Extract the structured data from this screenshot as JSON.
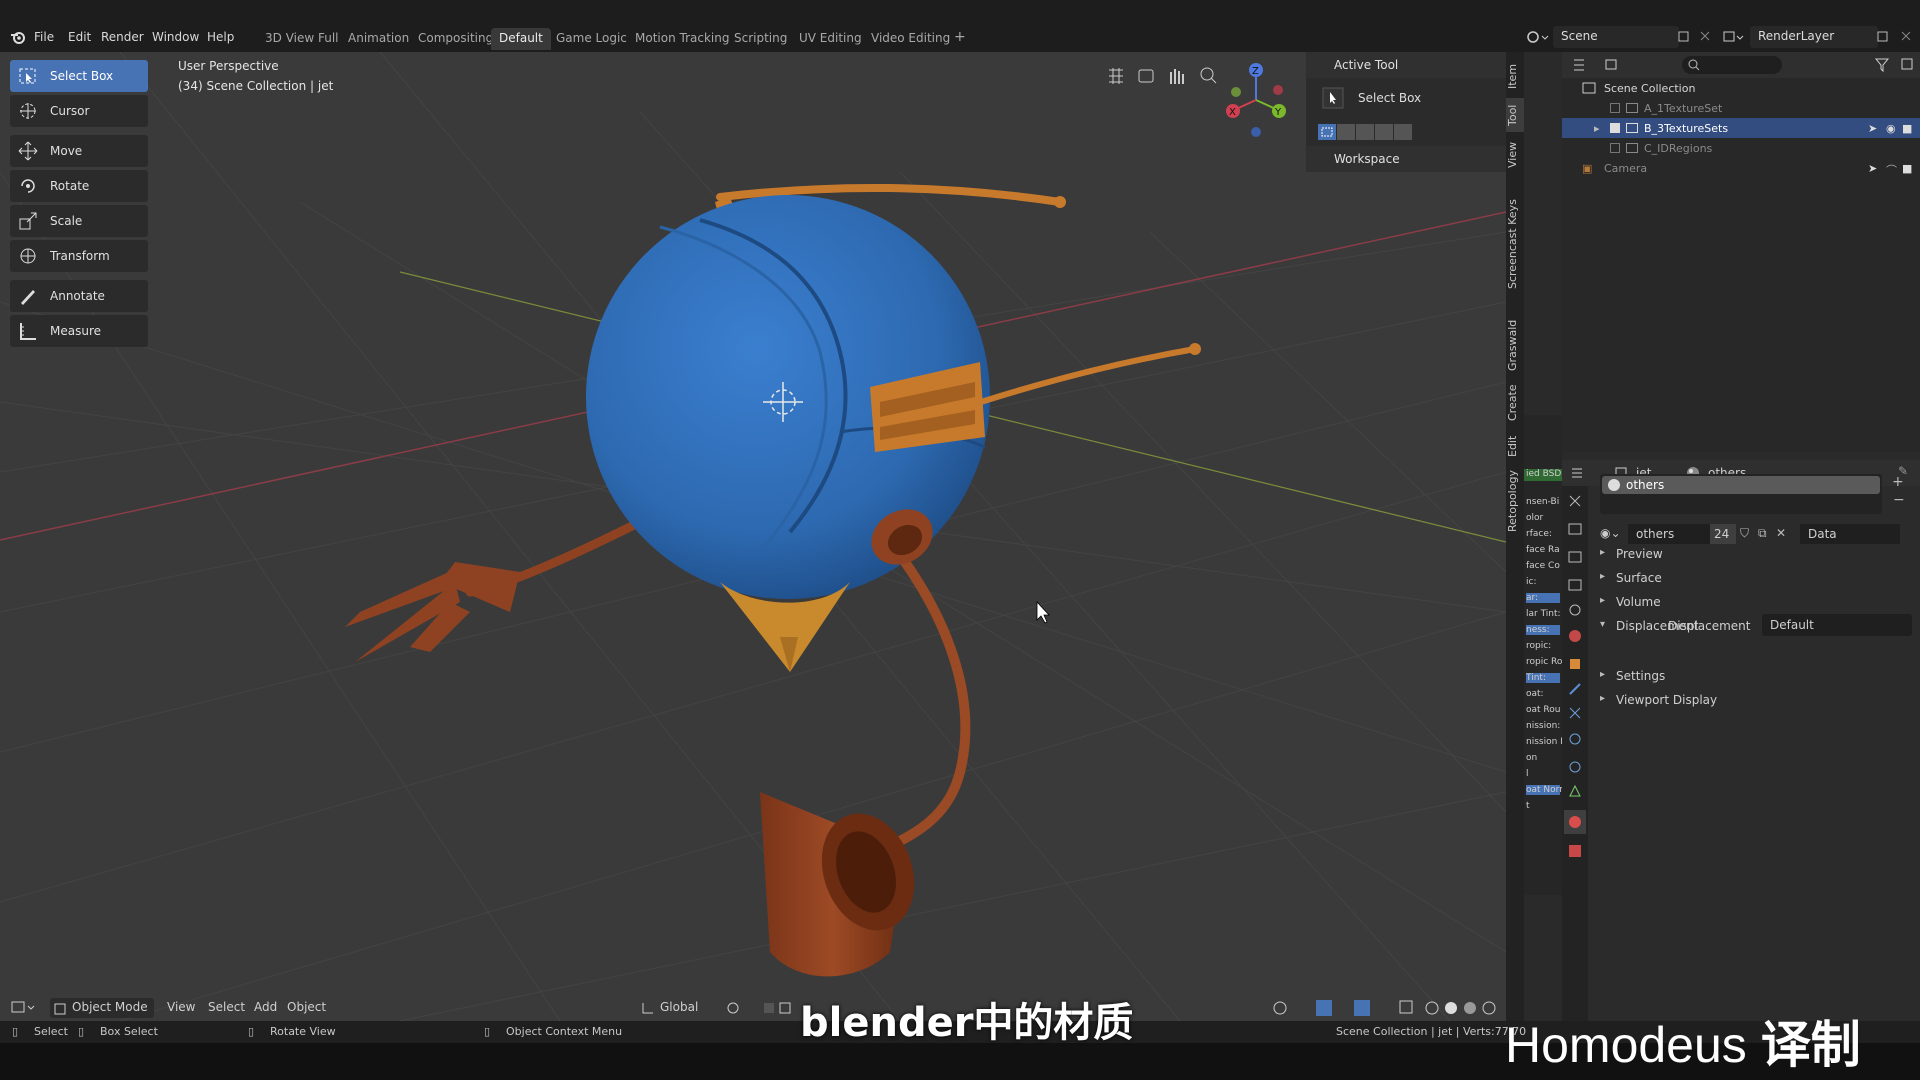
{
  "menu": [
    "File",
    "Edit",
    "Render",
    "Window",
    "Help"
  ],
  "workspace_tabs": [
    {
      "label": "3D View Full",
      "active": false
    },
    {
      "label": "Animation",
      "active": false
    },
    {
      "label": "Compositing",
      "active": false
    },
    {
      "label": "Default",
      "active": true
    },
    {
      "label": "Game Logic",
      "active": false
    },
    {
      "label": "Motion Tracking",
      "active": false
    },
    {
      "label": "Scripting",
      "active": false
    },
    {
      "label": "UV Editing",
      "active": false
    },
    {
      "label": "Video Editing",
      "active": false
    }
  ],
  "add_tab_label": "+",
  "scene_field": "Scene",
  "renderlayer_field": "RenderLayer",
  "viewport": {
    "perspective": "User Perspective",
    "collection_info": "(34) Scene Collection | jet"
  },
  "tools": [
    {
      "label": "Select Box",
      "icon": "select-box-icon",
      "active": true
    },
    {
      "label": "Cursor",
      "icon": "cursor-icon",
      "active": false
    },
    {
      "label": "Move",
      "icon": "move-icon",
      "active": false
    },
    {
      "label": "Rotate",
      "icon": "rotate-icon",
      "active": false
    },
    {
      "label": "Scale",
      "icon": "scale-icon",
      "active": false
    },
    {
      "label": "Transform",
      "icon": "transform-icon",
      "active": false
    },
    {
      "label": "Annotate",
      "icon": "annotate-icon",
      "active": false
    },
    {
      "label": "Measure",
      "icon": "measure-icon",
      "active": false
    }
  ],
  "npanel": {
    "active_tool_header": "Active Tool",
    "active_tool_name": "Select Box",
    "workspace_header": "Workspace"
  },
  "vertical_tabs": [
    "Item",
    "Tool",
    "View",
    "Screencast Keys",
    "Graswald",
    "Create",
    "Edit",
    "Retopology"
  ],
  "outliner": {
    "root": "Scene Collection",
    "items": [
      {
        "label": "A_1TextureSet",
        "selected": false
      },
      {
        "label": "B_3TextureSets",
        "selected": true
      },
      {
        "label": "C_IDRegions",
        "selected": false
      },
      {
        "label": "Camera",
        "selected": false
      }
    ]
  },
  "node_fragments": [
    "ied BSD",
    "nsen-Bi",
    "olor",
    "rface:",
    "face Ra",
    "face Co",
    "ic:",
    "ar:",
    "lar Tint:",
    "ness:",
    "ropic:",
    "ropic Ro",
    "Tint:",
    "oat:",
    "oat Rou",
    "nission:",
    "nission I",
    "on",
    "l",
    "oat Norm",
    "t"
  ],
  "properties": {
    "object_name": "jet",
    "material_name": "others",
    "slot_label": "others",
    "material_field": "others",
    "user_count": "24",
    "link_field": "Data",
    "sections": [
      {
        "label": "Preview",
        "open": false
      },
      {
        "label": "Surface",
        "open": false
      },
      {
        "label": "Volume",
        "open": false
      },
      {
        "label": "Displacement",
        "open": true
      },
      {
        "label": "Settings",
        "open": false
      },
      {
        "label": "Viewport Display",
        "open": false
      }
    ],
    "displacement_label": "Displacement",
    "displacement_value": "Default"
  },
  "bottom_header": {
    "mode": "Object Mode",
    "menus": [
      "View",
      "Select",
      "Add",
      "Object"
    ],
    "orientation": "Global"
  },
  "statusbar": {
    "select": "Select",
    "box_select": "Box Select",
    "rotate_view": "Rotate View",
    "context_menu": "Object Context Menu",
    "stats": "Scene Collection | jet | Verts:77,70"
  },
  "subtitle": "blender中的材质",
  "watermark_name": "Homodeus",
  "watermark_suffix": "译制",
  "colors": {
    "accent": "#4772b3",
    "sphere": "#2f6db5",
    "orange": "#c87a2c",
    "brown": "#8e4221",
    "viewport_bg": "#3a3a3a"
  }
}
